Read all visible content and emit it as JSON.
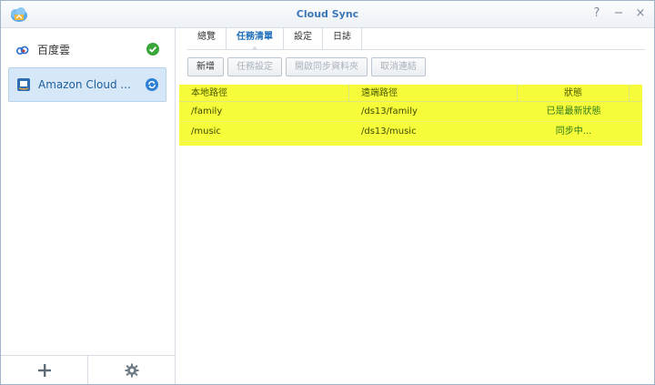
{
  "window": {
    "title": "Cloud Sync",
    "controls": [
      "?",
      "−",
      "×"
    ]
  },
  "sidebar": {
    "items": [
      {
        "label": "百度雲",
        "status": "ok"
      },
      {
        "label": "Amazon Cloud ...",
        "status": "syncing"
      }
    ]
  },
  "tabs": [
    "總覽",
    "任務清單",
    "設定",
    "日誌"
  ],
  "toolbar": {
    "new": "新增",
    "task_settings": "任務設定",
    "open_folder": "開啟同步資料夾",
    "unlink": "取消連結"
  },
  "table": {
    "columns": [
      "本地路徑",
      "遠端路徑",
      "狀態"
    ],
    "rows": [
      [
        "/family",
        "/ds13/family",
        "已是最新狀態"
      ],
      [
        "/music",
        "/ds13/music",
        "同步中..."
      ]
    ]
  },
  "colors": {
    "accent": "#1f6fba",
    "highlight": "#f6fb3a",
    "ok": "#3aa63a"
  }
}
